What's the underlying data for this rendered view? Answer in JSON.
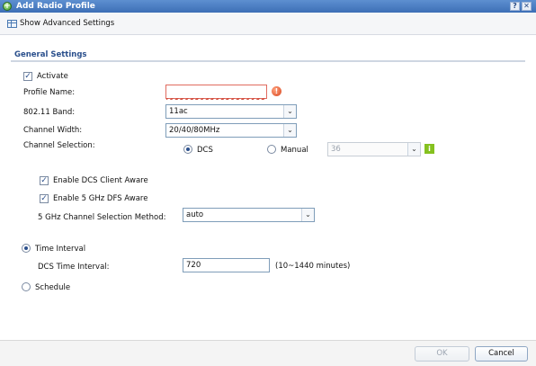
{
  "window": {
    "title": "Add Radio Profile",
    "help_label": "?",
    "close_label": "✕"
  },
  "toolbar": {
    "advanced_label": "Show Advanced Settings"
  },
  "section": {
    "title": "General Settings"
  },
  "form": {
    "activate_label": "Activate",
    "profile_name_label": "Profile Name:",
    "profile_name_value": "",
    "band_label": "802.11 Band:",
    "band_value": "11ac",
    "width_label": "Channel Width:",
    "width_value": "20/40/80MHz",
    "selection_label": "Channel Selection:",
    "dcs_label": "DCS",
    "manual_label": "Manual",
    "manual_value": "36",
    "enable_dcs_client_label": "Enable DCS Client Aware",
    "enable_5ghz_dfs_label": "Enable 5 GHz DFS Aware",
    "method_label": "5 GHz Channel Selection Method:",
    "method_value": "auto",
    "time_interval_label": "Time Interval",
    "dcs_time_interval_label": "DCS Time Interval:",
    "dcs_time_interval_value": "720",
    "dcs_time_interval_hint": "(10~1440 minutes)",
    "schedule_label": "Schedule"
  },
  "footer": {
    "ok_label": "OK",
    "cancel_label": "Cancel"
  },
  "icons": {
    "title_icon": "plus-circle-icon",
    "toolbar_icon": "table-icon",
    "error_icon": "error-icon",
    "info_icon": "info-icon"
  }
}
